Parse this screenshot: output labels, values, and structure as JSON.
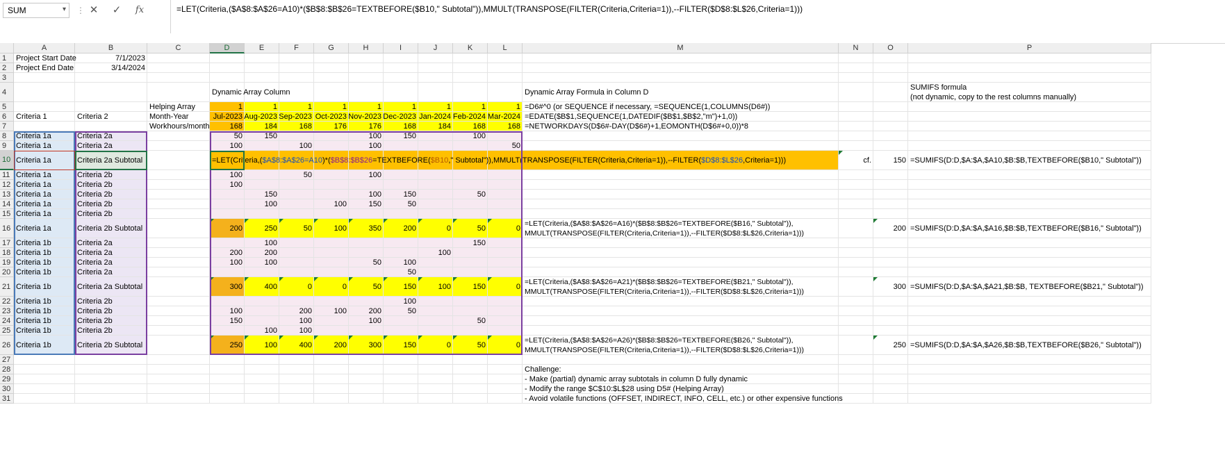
{
  "formula_bar": {
    "name_box": "SUM",
    "cancel_glyph": "✕",
    "enter_glyph": "✓",
    "fx_label": "fx",
    "formula": "=LET(Criteria,($A$8:$A$26=A10)*($B$8:$B$26=TEXTBEFORE($B10,\" Subtotal\")),MMULT(TRANSPOSE(FILTER(Criteria,Criteria=1)),--FILTER($D$8:$L$26,Criteria=1)))"
  },
  "columns": [
    "A",
    "B",
    "C",
    "D",
    "E",
    "F",
    "G",
    "H",
    "I",
    "J",
    "K",
    "L",
    "M",
    "N",
    "O",
    "P"
  ],
  "rows": [
    "1",
    "2",
    "3",
    "4",
    "5",
    "6",
    "7",
    "8",
    "9",
    "10",
    "11",
    "12",
    "13",
    "14",
    "15",
    "16",
    "17",
    "18",
    "19",
    "20",
    "21",
    "22",
    "23",
    "24",
    "25",
    "26",
    "27",
    "28",
    "29",
    "30",
    "31"
  ],
  "active_cell": "D10",
  "headers": {
    "a1": "Project Start Date",
    "b1": "7/1/2023",
    "a2": "Project End Date",
    "b2": "3/14/2024",
    "d4": "Dynamic Array Column",
    "m4": "Dynamic Array Formula in Column D",
    "p4": "SUMIFS formula\n(not dynamic, copy to the rest columns manually)",
    "c5": "Helping Array",
    "c6": "Month-Year",
    "c7": "Workhours/month",
    "a6": "Criteria 1",
    "b6": "Criteria 2"
  },
  "helping_array": [
    "1",
    "1",
    "1",
    "1",
    "1",
    "1",
    "1",
    "1",
    "1"
  ],
  "months": [
    "Jul-2023",
    "Aug-2023",
    "Sep-2023",
    "Oct-2023",
    "Nov-2023",
    "Dec-2023",
    "Jan-2024",
    "Feb-2024",
    "Mar-2024"
  ],
  "workhours": [
    "168",
    "184",
    "168",
    "176",
    "176",
    "168",
    "184",
    "168",
    "168"
  ],
  "notes_m": {
    "m5": "=D6#^0 (or SEQUENCE if necessary, =SEQUENCE(1,COLUMNS(D6#))",
    "m6": "=EDATE($B$1,SEQUENCE(1,DATEDIF($B$1,$B$2,\"m\")+1,0))",
    "m7": "=NETWORKDAYS(D$6#-DAY(D$6#)+1,EOMONTH(D$6#+0,0))*8"
  },
  "data_rows": [
    {
      "a": "Criteria 1a",
      "b": "Criteria  2a",
      "v": [
        "50",
        "150",
        "",
        "",
        "100",
        "150",
        "",
        "100",
        ""
      ]
    },
    {
      "a": "Criteria 1a",
      "b": "Criteria  2a",
      "v": [
        "100",
        "",
        "100",
        "",
        "100",
        "",
        "",
        "",
        "50"
      ]
    },
    {
      "a": "Criteria 1a",
      "b": "Criteria  2a Subtotal",
      "v": []
    },
    {
      "a": "Criteria 1a",
      "b": "Criteria 2b",
      "v": [
        "100",
        "",
        "50",
        "",
        "100",
        "",
        "",
        "",
        ""
      ]
    },
    {
      "a": "Criteria 1a",
      "b": "Criteria 2b",
      "v": [
        "100",
        "",
        "",
        "",
        "",
        "",
        "",
        "",
        ""
      ]
    },
    {
      "a": "Criteria 1a",
      "b": "Criteria 2b",
      "v": [
        "",
        "150",
        "",
        "",
        "100",
        "150",
        "",
        "50",
        ""
      ]
    },
    {
      "a": "Criteria 1a",
      "b": "Criteria 2b",
      "v": [
        "",
        "100",
        "",
        "100",
        "150",
        "50",
        "",
        "",
        ""
      ]
    },
    {
      "a": "Criteria 1a",
      "b": "Criteria 2b",
      "v": [
        "",
        "",
        "",
        "",
        "",
        "",
        "",
        "",
        ""
      ]
    },
    {
      "a": "Criteria 1a",
      "b": "Criteria 2b Subtotal",
      "v": [
        "200",
        "250",
        "50",
        "100",
        "350",
        "200",
        "0",
        "50",
        "0"
      ]
    },
    {
      "a": "Criteria 1b",
      "b": "Criteria  2a",
      "v": [
        "",
        "100",
        "",
        "",
        "",
        "",
        "",
        "150",
        ""
      ]
    },
    {
      "a": "Criteria 1b",
      "b": "Criteria  2a",
      "v": [
        "200",
        "200",
        "",
        "",
        "",
        "",
        "100",
        "",
        ""
      ]
    },
    {
      "a": "Criteria 1b",
      "b": "Criteria  2a",
      "v": [
        "100",
        "100",
        "",
        "",
        "50",
        "100",
        "",
        "",
        ""
      ]
    },
    {
      "a": "Criteria 1b",
      "b": "Criteria  2a",
      "v": [
        "",
        "",
        "",
        "",
        "",
        "50",
        "",
        "",
        ""
      ]
    },
    {
      "a": "Criteria 1b",
      "b": "Criteria  2a Subtotal",
      "v": [
        "300",
        "400",
        "0",
        "0",
        "50",
        "150",
        "100",
        "150",
        "0"
      ]
    },
    {
      "a": "Criteria 1b",
      "b": "Criteria 2b",
      "v": [
        "",
        "",
        "",
        "",
        "",
        "100",
        "",
        "",
        ""
      ]
    },
    {
      "a": "Criteria 1b",
      "b": "Criteria 2b",
      "v": [
        "100",
        "",
        "200",
        "100",
        "200",
        "50",
        "",
        "",
        ""
      ]
    },
    {
      "a": "Criteria 1b",
      "b": "Criteria 2b",
      "v": [
        "150",
        "",
        "100",
        "",
        "100",
        "",
        "",
        "50",
        ""
      ]
    },
    {
      "a": "Criteria 1b",
      "b": "Criteria 2b",
      "v": [
        "",
        "100",
        "100",
        "",
        "",
        "",
        "",
        "",
        ""
      ]
    },
    {
      "a": "Criteria 1b",
      "b": "Criteria 2b Subtotal",
      "v": [
        "250",
        "100",
        "400",
        "200",
        "300",
        "150",
        "0",
        "50",
        "0"
      ]
    }
  ],
  "row10": {
    "formula_parts": [
      "=LET(Criteria,(",
      "$A$8:$A$26=A10",
      ")*(",
      "$B$8:$B$26",
      "=TEXTBEFORE(",
      "$B10",
      ",\" Subtotal\")),MMULT(TRANSPOSE(FILTER(Criteria,Criteria=1)),--FILTER(",
      "$D$8:$L$26",
      ",Criteria=1)))"
    ],
    "n": "cf.",
    "o": "150",
    "p": "=SUMIFS(D:D,$A:$A,$A10,$B:$B,TEXTBEFORE($B10,\" Subtotal\"))"
  },
  "subtotal_notes": {
    "r16_m": "=LET(Criteria,($A$8:$A$26=A16)*($B$8:$B$26=TEXTBEFORE($B16,\" Subtotal\")),\nMMULT(TRANSPOSE(FILTER(Criteria,Criteria=1)),--FILTER($D$8:$L$26,Criteria=1)))",
    "r16_o": "200",
    "r16_p": "=SUMIFS(D:D,$A:$A,$A16,$B:$B,TEXTBEFORE($B16,\" Subtotal\"))",
    "r21_m": "=LET(Criteria,($A$8:$A$26=A21)*($B$8:$B$26=TEXTBEFORE($B21,\" Subtotal\")),\nMMULT(TRANSPOSE(FILTER(Criteria,Criteria=1)),--FILTER($D$8:$L$26,Criteria=1)))",
    "r21_o": "300",
    "r21_p": "=SUMIFS(D:D,$A:$A,$A21,$B:$B, TEXTBEFORE($B21,\" Subtotal\"))",
    "r26_m": "=LET(Criteria,($A$8:$A$26=A26)*($B$8:$B$26=TEXTBEFORE($B26,\" Subtotal\")),\nMMULT(TRANSPOSE(FILTER(Criteria,Criteria=1)),--FILTER($D$8:$L$26,Criteria=1)))",
    "r26_o": "250",
    "r26_p": "=SUMIFS(D:D,$A:$A,$A26,$B:$B,TEXTBEFORE($B26,\" Subtotal\"))"
  },
  "challenge": {
    "title": "Challenge:",
    "items": [
      "- Make (partial) dynamic array subtotals in column D fully dynamic",
      "- Modify the range $C$10:$L$28 using D5# (Helping Array)",
      "- Avoid volatile functions (OFFSET, INDIRECT, INFO, CELL, etc.) or other expensive functions"
    ]
  },
  "colors": {
    "yellow": "#ffff00",
    "orange": "#ffc000",
    "orange_dark": "#f4b11c",
    "light_blue": "#dde9f5",
    "light_purple": "#ece6f4",
    "light_pink": "#f7e9f1",
    "green_accent": "#217346"
  }
}
